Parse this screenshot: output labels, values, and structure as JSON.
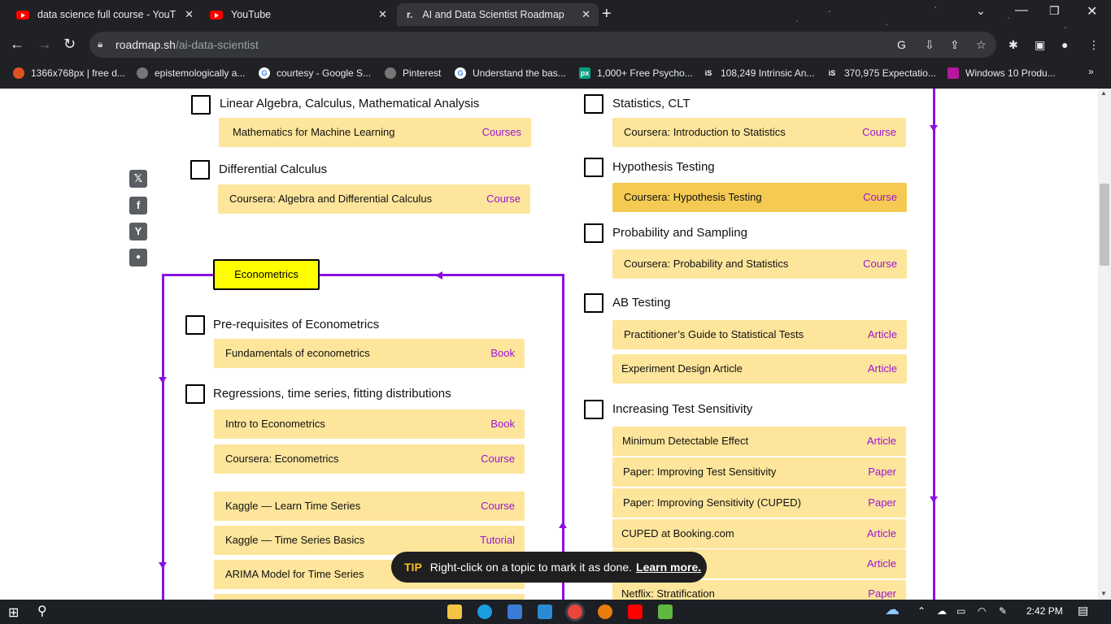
{
  "tabs": [
    {
      "title": "data science full course - YouTub",
      "icon": "youtube-icon",
      "active": false
    },
    {
      "title": "YouTube",
      "icon": "youtube-icon",
      "active": false
    },
    {
      "title": "AI and Data Scientist Roadmap",
      "icon": "roadmap-icon",
      "active": true
    }
  ],
  "window": {
    "minimize": "⌄",
    "new_tab": "+"
  },
  "address": {
    "host": "roadmap.sh",
    "path": "/ai-data-scientist"
  },
  "bookmarks": [
    {
      "label": "1366x768px | free d...",
      "icon": "flame-icon"
    },
    {
      "label": "epistemologically a...",
      "icon": "globe-icon"
    },
    {
      "label": "courtesy - Google S...",
      "icon": "google-icon"
    },
    {
      "label": "Pinterest",
      "icon": "globe-icon"
    },
    {
      "label": "Understand the bas...",
      "icon": "google-icon"
    },
    {
      "label": "1,000+ Free Psycho...",
      "icon": "pexels-icon"
    },
    {
      "label": "108,249 Intrinsic An...",
      "icon": "istock-icon"
    },
    {
      "label": "370,975 Expectatio...",
      "icon": "istock-icon"
    },
    {
      "label": "Windows 10 Produ...",
      "icon": "windows-icon"
    }
  ],
  "left_topics": [
    {
      "title": "Linear Algebra, Calculus, Mathematical Analysis",
      "resources": [
        {
          "title": "Mathematics for Machine Learning",
          "kind": "Courses"
        }
      ]
    },
    {
      "title": "Differential Calculus",
      "resources": [
        {
          "title": "Coursera: Algebra and Differential Calculus",
          "kind": "Course"
        }
      ]
    }
  ],
  "econometrics": {
    "label": "Econometrics",
    "topics": [
      {
        "title": "Pre-requisites of Econometrics",
        "resources": [
          {
            "title": "Fundamentals of econometrics",
            "kind": "Book"
          }
        ]
      },
      {
        "title": "Regressions, time series, fitting distributions",
        "resources": [
          {
            "title": "Intro to Econometrics",
            "kind": "Book"
          },
          {
            "title": "Coursera: Econometrics",
            "kind": "Course"
          },
          {
            "title": "Kaggle — Learn Time Series",
            "kind": "Course"
          },
          {
            "title": "Kaggle — Time Series Basics",
            "kind": "Tutorial"
          },
          {
            "title": "ARIMA Model for Time Series",
            "kind": ""
          }
        ]
      }
    ]
  },
  "right_topics": [
    {
      "title": "Statistics, CLT",
      "resources": [
        {
          "title": "Coursera: Introduction to Statistics",
          "kind": "Course"
        }
      ]
    },
    {
      "title": "Hypothesis Testing",
      "resources": [
        {
          "title": "Coursera: Hypothesis Testing",
          "kind": "Course"
        }
      ]
    },
    {
      "title": "Probability and Sampling",
      "resources": [
        {
          "title": "Coursera: Probability and Statistics",
          "kind": "Course"
        }
      ]
    },
    {
      "title": "AB Testing",
      "resources": [
        {
          "title": "Practitioner’s Guide to Statistical Tests",
          "kind": "Article"
        },
        {
          "title": "Experiment Design Article",
          "kind": "Article"
        }
      ]
    },
    {
      "title": "Increasing Test Sensitivity",
      "resources": [
        {
          "title": "Minimum Detectable Effect",
          "kind": "Article"
        },
        {
          "title": "Paper: Improving Test Sensitivity",
          "kind": "Paper"
        },
        {
          "title": "Paper: Improving Sensitivity (CUPED)",
          "kind": "Paper"
        },
        {
          "title": "CUPED at Booking.com",
          "kind": "Article"
        },
        {
          "title": "",
          "kind": "Article"
        },
        {
          "title": "Netflix: Stratification",
          "kind": "Paper"
        }
      ]
    }
  ],
  "share": [
    {
      "icon": "x-twitter-icon",
      "glyph": "𝕏"
    },
    {
      "icon": "facebook-icon",
      "glyph": "f"
    },
    {
      "icon": "hackernews-icon",
      "glyph": "Y"
    },
    {
      "icon": "reddit-icon",
      "glyph": "●"
    }
  ],
  "tip": {
    "label": "TIP",
    "text": "Right-click on a topic to mark it as done.",
    "link": "Learn more."
  },
  "taskbar": {
    "time": "2:42 PM"
  },
  "colors": {
    "accent": "#8a10e0",
    "resource_bg": "#fde59b",
    "resource_highlight": "#f5ca52",
    "econ_box": "#ffff00",
    "link": "#9b15d6"
  }
}
